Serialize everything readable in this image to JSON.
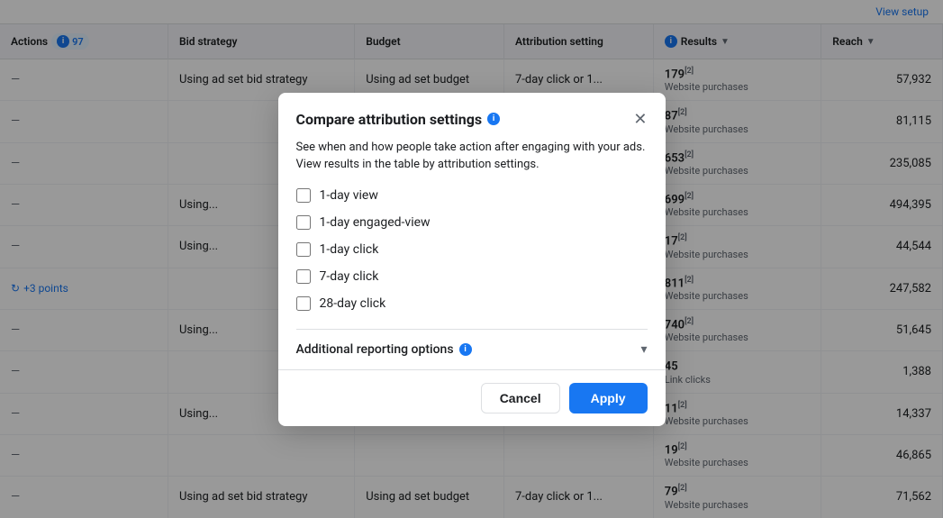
{
  "topbar": {
    "view_setup_label": "View setup"
  },
  "table": {
    "headers": {
      "actions": "Actions",
      "actions_count": "97",
      "bid_strategy": "Bid strategy",
      "budget": "Budget",
      "attribution_setting": "Attribution setting",
      "results": "Results",
      "reach": "Reach"
    },
    "rows": [
      {
        "bid": "Using ad set bid strategy",
        "budget": "Using ad set budget",
        "attribution": "7-day click or 1...",
        "results_num": "179",
        "results_sup": "[2]",
        "results_label": "Website purchases",
        "reach": "57,932",
        "has_dash": true
      },
      {
        "bid": "",
        "budget": "",
        "attribution": "",
        "results_num": "87",
        "results_sup": "[2]",
        "results_label": "Website purchases",
        "reach": "81,115",
        "has_dash": true
      },
      {
        "bid": "",
        "budget": "",
        "attribution": "",
        "results_num": "653",
        "results_sup": "[2]",
        "results_label": "Website purchases",
        "reach": "235,085",
        "has_dash": true
      },
      {
        "bid": "Using...",
        "budget": "",
        "attribution": "",
        "results_num": "699",
        "results_sup": "[2]",
        "results_label": "Website purchases",
        "reach": "494,395",
        "has_dash": true
      },
      {
        "bid": "Using...",
        "budget": "",
        "attribution": "",
        "results_num": "17",
        "results_sup": "[2]",
        "results_label": "Website purchases",
        "reach": "44,544",
        "has_dash": true
      },
      {
        "bid": "",
        "budget": "",
        "attribution": "",
        "results_num": "811",
        "results_sup": "[2]",
        "results_label": "Website purchases",
        "reach": "247,582",
        "has_dash": false,
        "points_label": "+3 points"
      },
      {
        "bid": "Using...",
        "budget": "",
        "attribution": "",
        "results_num": "740",
        "results_sup": "[2]",
        "results_label": "Website purchases",
        "reach": "51,645",
        "has_dash": true
      },
      {
        "bid": "",
        "budget": "",
        "attribution": "",
        "results_num": "45",
        "results_sup": "",
        "results_label": "Link clicks",
        "reach": "1,388",
        "has_dash": true
      },
      {
        "bid": "Using...",
        "budget": "",
        "attribution": "",
        "results_num": "11",
        "results_sup": "[2]",
        "results_label": "Website purchases",
        "reach": "14,337",
        "has_dash": true
      },
      {
        "bid": "",
        "budget": "",
        "attribution": "",
        "results_num": "19",
        "results_sup": "[2]",
        "results_label": "Website purchases",
        "reach": "46,865",
        "has_dash": true
      },
      {
        "bid": "Using ad set bid strategy",
        "budget": "Using ad set budget",
        "attribution": "7-day click or 1...",
        "results_num": "79",
        "results_sup": "[2]",
        "results_label": "Website purchases",
        "reach": "71,562",
        "has_dash": true
      }
    ]
  },
  "modal": {
    "title": "Compare attribution settings",
    "description": "See when and how people take action after engaging with your ads. View results in the table by attribution settings.",
    "checkboxes": [
      {
        "id": "cb1",
        "label": "1-day view",
        "checked": false
      },
      {
        "id": "cb2",
        "label": "1-day engaged-view",
        "checked": false
      },
      {
        "id": "cb3",
        "label": "1-day click",
        "checked": false
      },
      {
        "id": "cb4",
        "label": "7-day click",
        "checked": false
      },
      {
        "id": "cb5",
        "label": "28-day click",
        "checked": false
      }
    ],
    "additional_options_label": "Additional reporting options",
    "cancel_label": "Cancel",
    "apply_label": "Apply"
  }
}
